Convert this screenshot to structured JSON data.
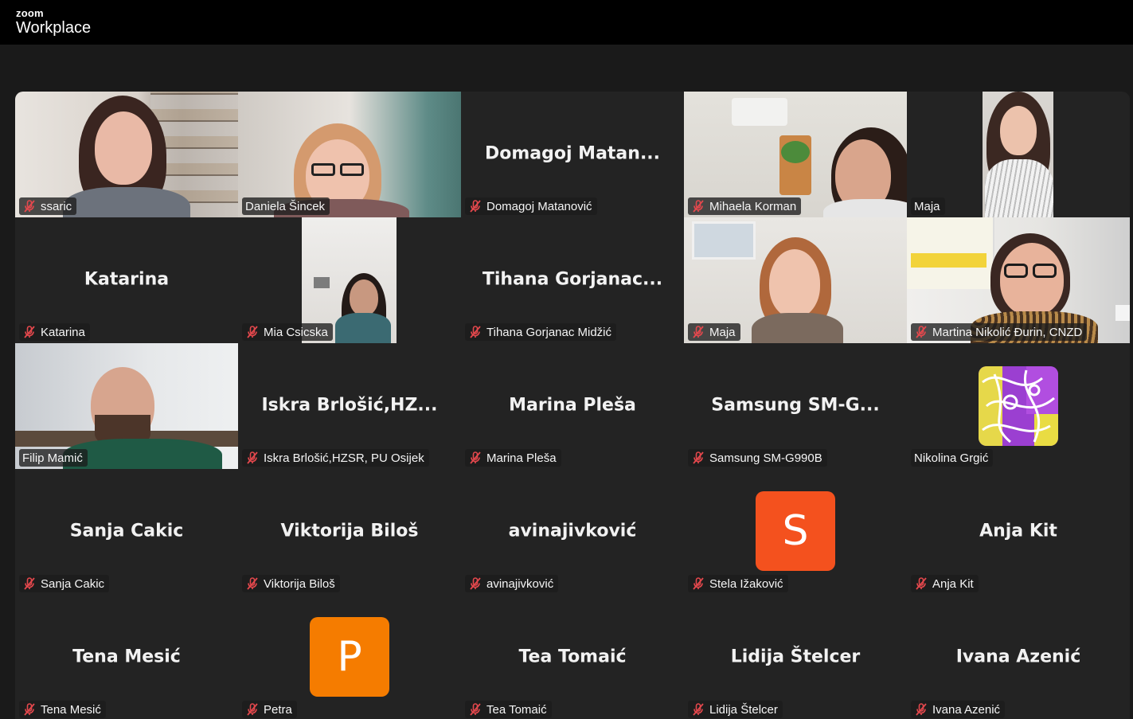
{
  "app": {
    "brand_small": "zoom",
    "brand_big": "Workplace"
  },
  "tiles": [
    {
      "name": "ssaric",
      "muted": true
    },
    {
      "name": "Daniela Šincek",
      "muted": false
    },
    {
      "name": "Domagoj Matanović",
      "display": "Domagoj  Matan...",
      "muted": true
    },
    {
      "name": "Mihaela Korman",
      "muted": true
    },
    {
      "name": "Maja",
      "muted": false
    },
    {
      "name": "Katarina",
      "display": "Katarina",
      "muted": true
    },
    {
      "name": "Mia Csicska",
      "muted": true
    },
    {
      "name": "Tihana Gorjanac Midžić",
      "display": "Tihana  Gorjanac...",
      "muted": true
    },
    {
      "name": "Maja",
      "muted": true
    },
    {
      "name": "Martina Nikolić Đurin, CNZD",
      "muted": true
    },
    {
      "name": "Filip Mamić",
      "muted": false,
      "active_speaker": true
    },
    {
      "name": "Iskra Brlošić,HZSR, PU Osijek",
      "display": "Iskra  Brlošić,HZ...",
      "muted": true
    },
    {
      "name": "Marina Pleša",
      "display": "Marina Pleša",
      "muted": true
    },
    {
      "name": "Samsung SM-G990B",
      "display": "Samsung  SM-G...",
      "muted": true
    },
    {
      "name": "Nikolina Grgić",
      "muted": false
    },
    {
      "name": "Sanja Cakic",
      "display": "Sanja Cakic",
      "muted": true
    },
    {
      "name": "Viktorija Biloš",
      "display": "Viktorija Biloš",
      "muted": true
    },
    {
      "name": "avinajivković",
      "display": "avinajivković",
      "muted": true
    },
    {
      "name": "Stela Ižaković",
      "avatar_letter": "S",
      "muted": true
    },
    {
      "name": "Anja Kit",
      "display": "Anja Kit",
      "muted": true
    },
    {
      "name": "Tena Mesić",
      "display": "Tena Mesić",
      "muted": true
    },
    {
      "name": "Petra",
      "avatar_letter": "P",
      "muted": true
    },
    {
      "name": "Tea Tomaić",
      "display": "Tea Tomaić",
      "muted": true
    },
    {
      "name": "Lidija Štelcer",
      "display": "Lidija Štelcer",
      "muted": true
    },
    {
      "name": "Ivana Azenić",
      "display": "Ivana Azenić",
      "muted": true
    }
  ],
  "colors": {
    "active_speaker_border": "#2ed47a",
    "muted_icon": "#e5484d",
    "avatar_s": "#f4511e",
    "avatar_p": "#f57c00"
  }
}
